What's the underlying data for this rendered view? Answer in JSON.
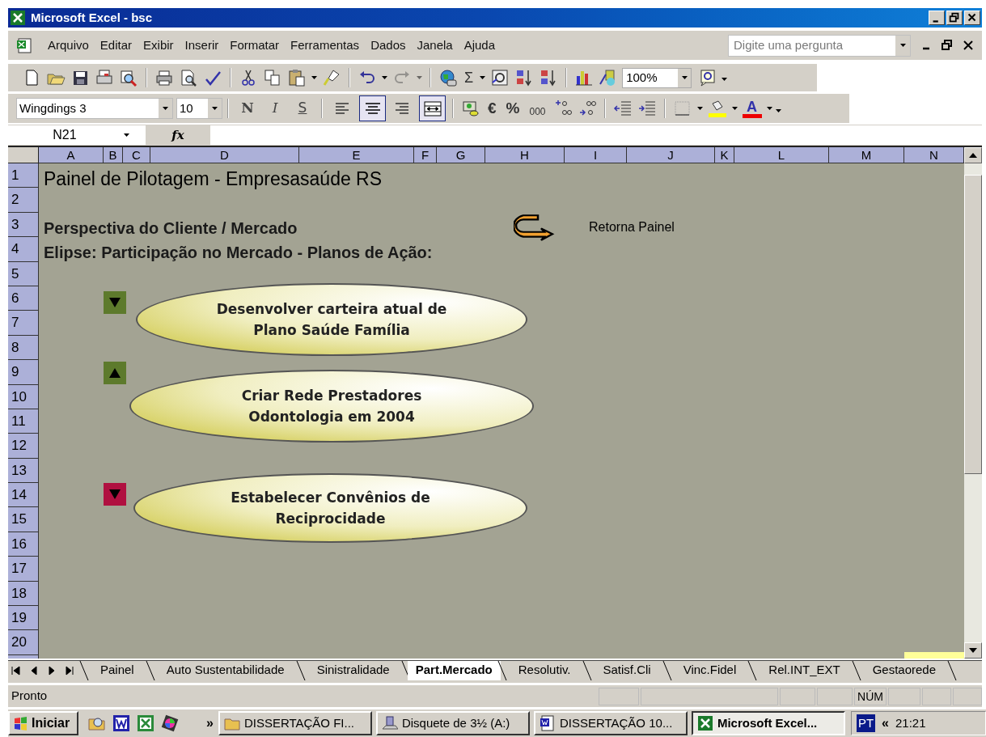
{
  "window": {
    "title": "Microsoft Excel - bsc"
  },
  "menu": [
    "Arquivo",
    "Editar",
    "Exibir",
    "Inserir",
    "Formatar",
    "Ferramentas",
    "Dados",
    "Janela",
    "Ajuda"
  ],
  "help_box": {
    "placeholder": "Digite uma pergunta"
  },
  "standard_toolbar": {
    "sum_glyph": "Σ",
    "zoom": "100%"
  },
  "format_toolbar": {
    "font": "Wingdings 3",
    "size": "10",
    "style_glyphs": [
      "N",
      "I",
      "S"
    ],
    "alignment": [
      {
        "pressed": false
      },
      {
        "pressed": true
      },
      {
        "pressed": false
      },
      {
        "pressed": true
      }
    ],
    "number_glyphs": [
      "€",
      "%",
      "000"
    ],
    "font_color_glyph": "A"
  },
  "formula_bar": {
    "name_box": "N21",
    "fx": "fx"
  },
  "columns": [
    "A",
    "B",
    "C",
    "D",
    "E",
    "F",
    "G",
    "H",
    "I",
    "J",
    "K",
    "L",
    "M",
    "N"
  ],
  "rows": [
    "1",
    "2",
    "3",
    "4",
    "5",
    "6",
    "7",
    "8",
    "9",
    "10",
    "11",
    "12",
    "13",
    "14",
    "15",
    "16",
    "17",
    "18",
    "19",
    "20"
  ],
  "cells": [
    {
      "text": "Painel de Pilotagem - Empresasaúde RS",
      "kind": "title"
    },
    {
      "text": "Perspectiva do Cliente / Mercado",
      "kind": "heading"
    },
    {
      "text": "Retorna Painel",
      "kind": "link"
    },
    {
      "text": "Elipse: Participação no Mercado - Planos de Ação:",
      "kind": "heading"
    }
  ],
  "action_plans": [
    {
      "lines": [
        "Desenvolver carteira atual de",
        "Plano Saúde Família"
      ],
      "indicator": {
        "color": "#5d7a2c",
        "kind": "down"
      }
    },
    {
      "lines": [
        "Criar Rede Prestadores",
        "Odontologia em 2004"
      ],
      "indicator": {
        "color": "#5d7a2c",
        "kind": "up"
      }
    },
    {
      "lines": [
        "Estabelecer Convênios de",
        "Reciprocidade"
      ],
      "indicator": {
        "color": "#b01040",
        "kind": "down"
      }
    }
  ],
  "sheet_tabs": [
    {
      "label": "Painel",
      "selected": false
    },
    {
      "label": "Auto Sustentabilidade",
      "selected": false
    },
    {
      "label": "Sinistralidade",
      "selected": false
    },
    {
      "label": "Part.Mercado",
      "selected": true
    },
    {
      "label": "Resolutiv.",
      "selected": false
    },
    {
      "label": "Satisf.Cli",
      "selected": false
    },
    {
      "label": "Vinc.Fidel",
      "selected": false
    },
    {
      "label": "Rel.INT_EXT",
      "selected": false
    },
    {
      "label": "Gestaorede",
      "selected": false
    }
  ],
  "status_bar": {
    "status": "Pronto",
    "num_lock": "NÚM"
  },
  "taskbar": {
    "start": "Iniciar",
    "more": "»",
    "tasks": [
      {
        "label": "DISSERTAÇÃO FI...",
        "kind": "folder",
        "selected": false
      },
      {
        "label": "Disquete de 3½ (A:)",
        "kind": "drive",
        "selected": false
      },
      {
        "label": "DISSERTAÇÃO 10...",
        "kind": "word",
        "selected": false
      },
      {
        "label": "Microsoft Excel...",
        "kind": "excel",
        "selected": true
      }
    ],
    "language": "PT",
    "expand": "«",
    "clock": "21:21"
  }
}
